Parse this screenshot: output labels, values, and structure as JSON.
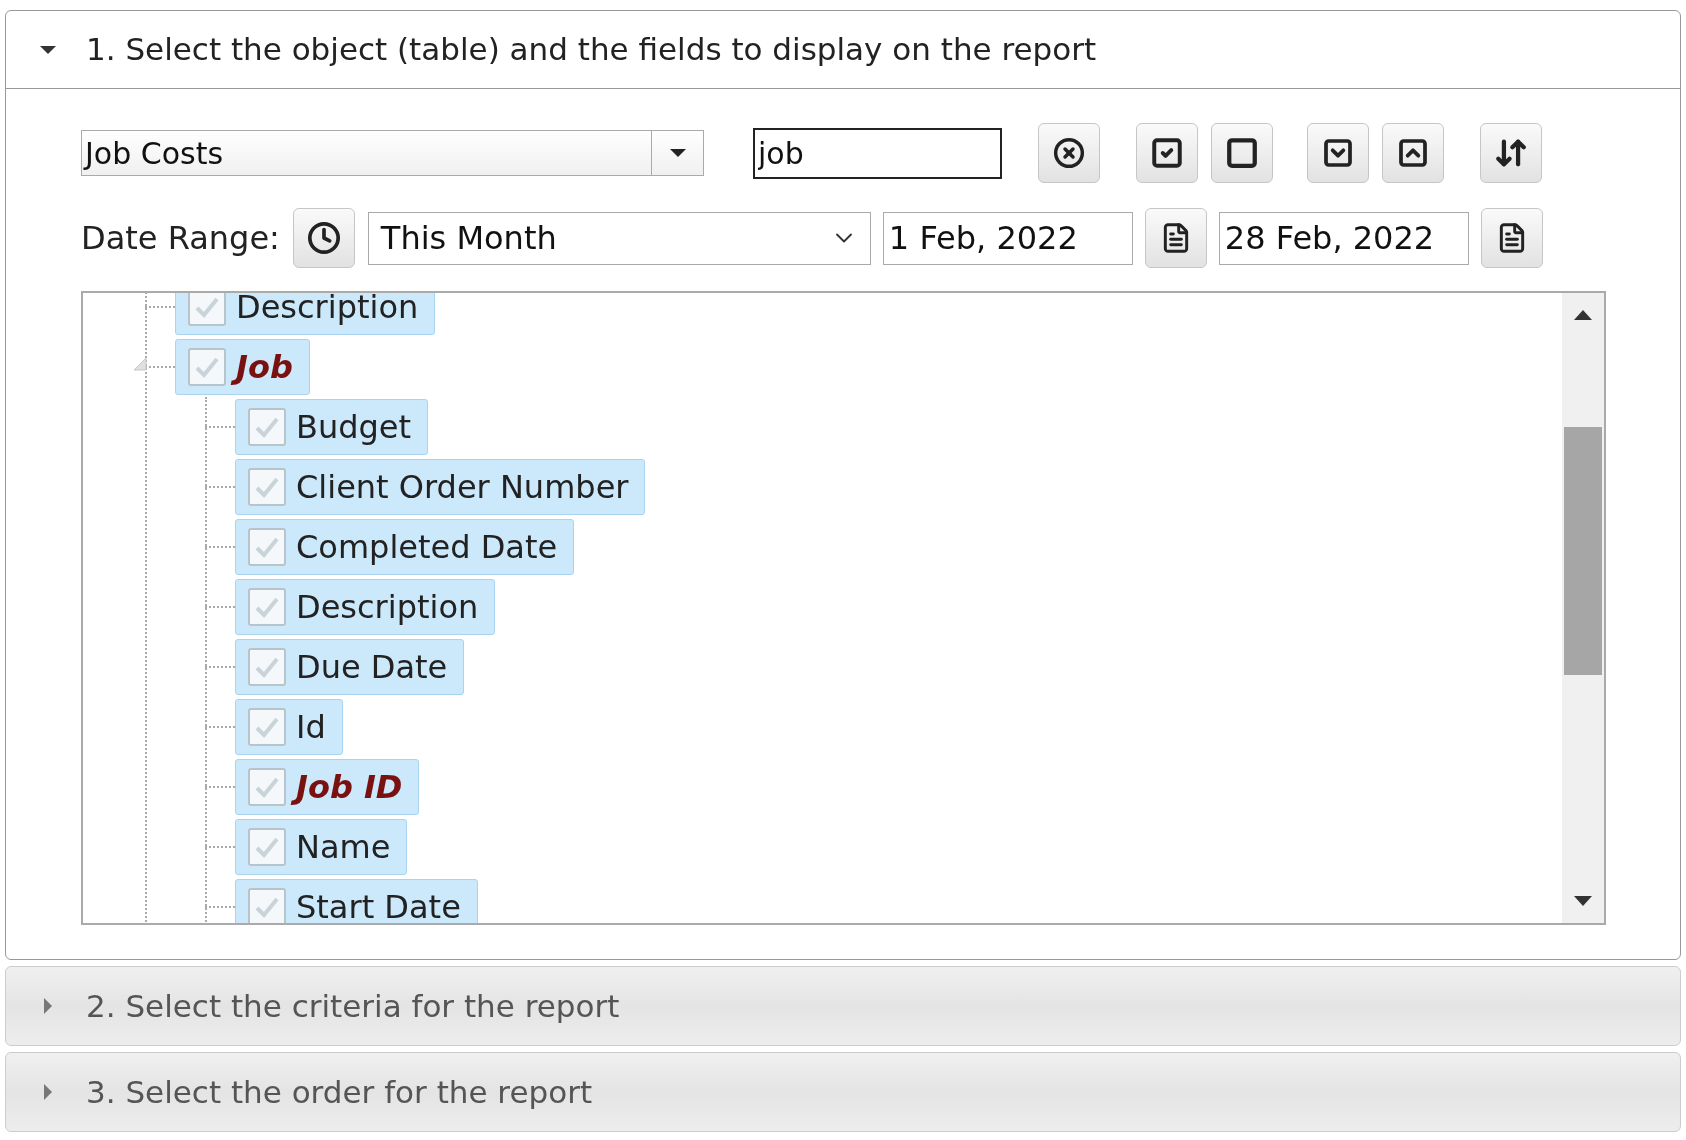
{
  "sections": [
    {
      "title": "1. Select the object (table) and the fields to display on the report",
      "expanded": true,
      "object_select": {
        "value": "Job Costs"
      },
      "search": {
        "value": "job"
      },
      "date_range": {
        "label": "Date Range:",
        "period": "This Month",
        "from": "1 Feb, 2022",
        "to": "28 Feb, 2022"
      },
      "tree": [
        {
          "label": "Description",
          "checked": true,
          "emphasized": false
        },
        {
          "label": "Job",
          "checked": true,
          "emphasized": true,
          "expanded": true,
          "children": [
            {
              "label": "Budget",
              "checked": true,
              "emphasized": false
            },
            {
              "label": "Client Order Number",
              "checked": true,
              "emphasized": false
            },
            {
              "label": "Completed Date",
              "checked": true,
              "emphasized": false
            },
            {
              "label": "Description",
              "checked": true,
              "emphasized": false
            },
            {
              "label": "Due Date",
              "checked": true,
              "emphasized": false
            },
            {
              "label": "Id",
              "checked": true,
              "emphasized": false
            },
            {
              "label": "Job ID",
              "checked": true,
              "emphasized": true
            },
            {
              "label": "Name",
              "checked": true,
              "emphasized": false
            },
            {
              "label": "Start Date",
              "checked": true,
              "emphasized": false
            }
          ]
        }
      ]
    },
    {
      "title": "2. Select the criteria for the report",
      "expanded": false
    },
    {
      "title": "3. Select the order for the report",
      "expanded": false
    }
  ]
}
